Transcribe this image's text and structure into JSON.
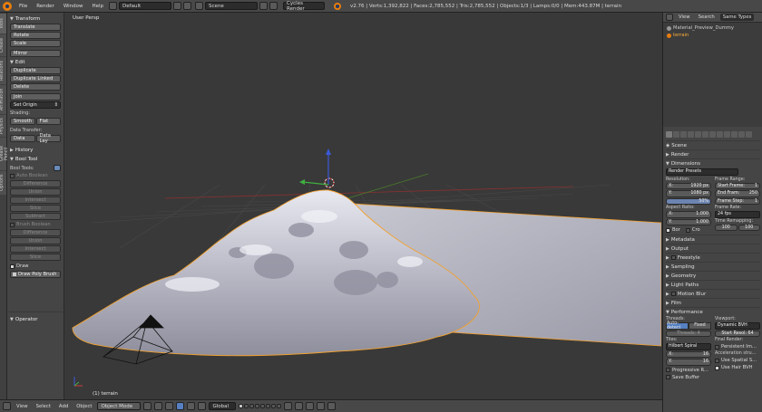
{
  "topbar": {
    "menus": [
      "File",
      "Render",
      "Window",
      "Help"
    ],
    "layout": "Default",
    "scene": "Scene",
    "engine": "Cycles Render",
    "stats": "v2.76 | Verts:1,392,822 | Faces:2,785,552 | Tris:2,785,552 | Objects:1/3 | Lamps:0/0 | Mem:443.87M | terrain"
  },
  "lefttabs": [
    "Tools",
    "Create",
    "Relations",
    "Animation",
    "Physics",
    "Grease Pencil",
    "Options"
  ],
  "tools": {
    "transform_header": "Transform",
    "translate": "Translate",
    "rotate": "Rotate",
    "scale": "Scale",
    "mirror": "Mirror",
    "edit_header": "Edit",
    "duplicate": "Duplicate",
    "duplicate_linked": "Duplicate Linked",
    "delete": "Delete",
    "join": "Join",
    "set_origin": "Set Origin",
    "shading_label": "Shading:",
    "smooth": "Smooth",
    "flat": "Flat",
    "data_transfer_label": "Data Transfer:",
    "data": "Data",
    "data_lay": "Data Lay",
    "history_header": "History",
    "bool_header": "Bool Tool",
    "bool_tools_label": "Bool Tools:",
    "auto_boolean": "Auto Boolean",
    "auto_items": [
      "Difference",
      "Union",
      "Intersect",
      "Slice",
      "Subtract"
    ],
    "brush_boolean": "Brush Boolean",
    "brush_items": [
      "Difference",
      "Union",
      "Intersect",
      "Slice"
    ],
    "draw": "Draw",
    "draw_poly_brush": "Draw Poly Brush"
  },
  "operator_header": "Operator",
  "viewport": {
    "label": "User Persp",
    "object_label": "(1) terrain"
  },
  "outliner": {
    "tabs": [
      "View",
      "Search",
      "Same Types"
    ],
    "items": [
      "Material_Preview_Dummy",
      "terrain"
    ]
  },
  "properties": {
    "scene": "Scene",
    "render": "Render",
    "dimensions": "Dimensions",
    "render_presets": "Render Presets",
    "resolution_label": "Resolution:",
    "res_x_label": "X:",
    "res_x": "1920 px",
    "res_y_label": "Y:",
    "res_y": "1080 px",
    "res_pct": "50%",
    "frame_range_label": "Frame Range:",
    "start_label": "Start Frame:",
    "start": "1",
    "end_label": "End Fram:",
    "end": "250",
    "step_label": "Frame Step:",
    "step": "1",
    "aspect_label": "Aspect Ratio:",
    "asp_x": "1.000",
    "asp_y": "1.000",
    "frame_rate_label": "Frame Rate:",
    "fps": "24 fps",
    "time_remap_label": "Time Remapping:",
    "remap_old": "100",
    "remap_new": "100",
    "bor": "Bor",
    "cro": "Cro",
    "sections": [
      "Metadata",
      "Output",
      "Freestyle",
      "Sampling",
      "Geometry",
      "Light Paths",
      "Motion Blur",
      "Film",
      "Performance"
    ],
    "threads_label": "Threads:",
    "auto_detect": "Auto-detect",
    "fixed": "Fixed",
    "threads_field": "Threads: 4",
    "viewport_label": "Viewport:",
    "dynamic_bvh": "Dynamic BVH",
    "start_resol": "Start Resol: 64",
    "tiles_label": "Tiles:",
    "hilbert_spiral": "Hilbert Spiral",
    "tile_x": "16",
    "tile_y": "16",
    "final_render_label": "Final Render:",
    "persistent_im": "Persistent Im...",
    "accel_label": "Acceleration stru...",
    "progressive": "Progressive R...",
    "use_spatial": "Use Spatial S...",
    "use_hair": "Use Hair BVH",
    "save_buffer": "Save Buffer"
  },
  "bottombar": {
    "menus": [
      "View",
      "Select",
      "Add",
      "Object"
    ],
    "mode": "Object Mode",
    "orientation": "Global"
  },
  "colors": {
    "bg": "#393939",
    "panel": "#454545",
    "accent": "#5680c2",
    "selected": "#ffb13b",
    "mesh": "#c9c9d3"
  }
}
